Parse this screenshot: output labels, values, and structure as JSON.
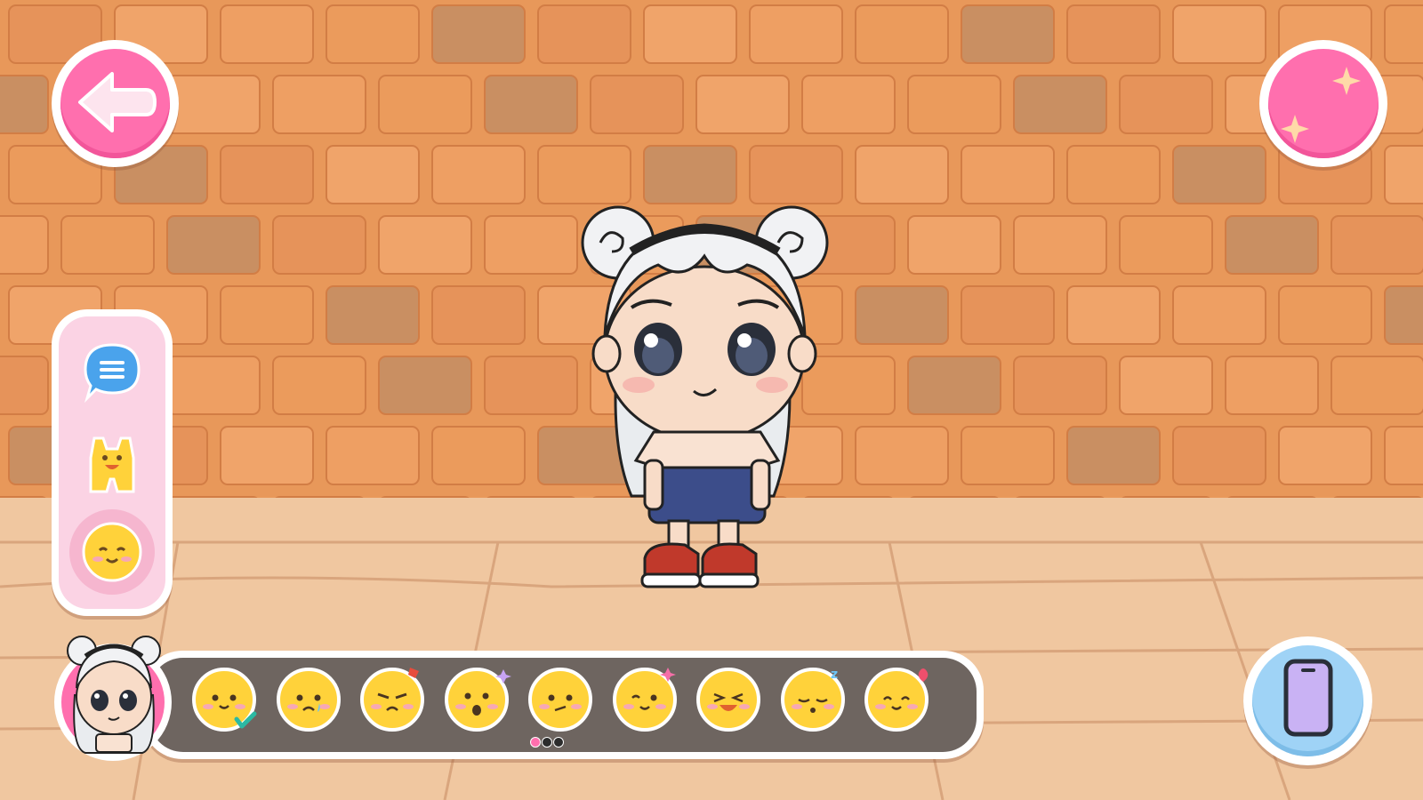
{
  "scene": {
    "wall_color": "#e8985a",
    "floor_color": "#f0c7a0"
  },
  "top_bar": {
    "back_icon": "arrow-left-icon",
    "effects_icon": "sparkle-icon"
  },
  "side_menu": {
    "items": [
      {
        "icon": "chat-bubble-icon"
      },
      {
        "icon": "outfit-icon"
      },
      {
        "icon": "emotion-smile-icon",
        "selected": true
      }
    ]
  },
  "emotion_bar": {
    "avatar_icon": "character-avatar-icon",
    "emotions": [
      {
        "icon": "smile-emoji-icon",
        "selected": true
      },
      {
        "icon": "sad-crying-emoji-icon"
      },
      {
        "icon": "angry-emoji-icon"
      },
      {
        "icon": "surprised-emoji-icon"
      },
      {
        "icon": "confused-emoji-icon"
      },
      {
        "icon": "winking-emoji-icon"
      },
      {
        "icon": "laughing-emoji-icon"
      },
      {
        "icon": "sleepy-emoji-icon"
      },
      {
        "icon": "in-love-emoji-icon"
      }
    ],
    "pages": 3,
    "current_page": 1
  },
  "bottom_right": {
    "phone_icon": "phone-icon"
  },
  "colors": {
    "accent_pink": "#ff6fae",
    "panel_pink": "#fbd3e4",
    "phone_blue": "#9fd3f6",
    "bar_dark": "#6e6560",
    "emoji_yellow": "#ffd23a"
  }
}
